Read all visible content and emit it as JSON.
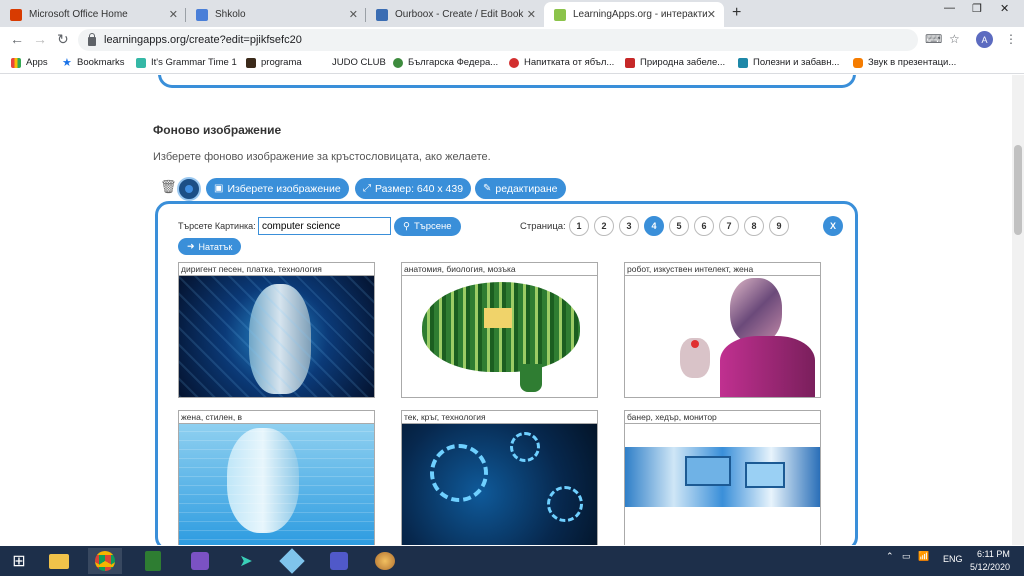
{
  "browser": {
    "tabs": [
      {
        "title": "Microsoft Office Home",
        "icon": "office-icon",
        "color": "#d83b01"
      },
      {
        "title": "Shkolo",
        "icon": "shkolo-icon",
        "color": "#4a7fd8"
      },
      {
        "title": "Ourboox - Create / Edit Book",
        "icon": "ourboox-icon",
        "color": "#3b6db3"
      },
      {
        "title": "LearningApps.org - интерактиви",
        "icon": "learningapps-icon",
        "color": "#8bc34a"
      }
    ],
    "url": "learningapps.org/create?edit=pjikfsefc20",
    "avatar_letter": "A",
    "bookmarks": [
      {
        "label": "Apps",
        "icon": "apps-grid-icon",
        "color": "#e8453c"
      },
      {
        "label": "Bookmarks",
        "icon": "star-icon",
        "color": "#1a73e8"
      },
      {
        "label": "It's Grammar Time 1",
        "icon": "send-icon",
        "color": "#35b8a6"
      },
      {
        "label": "programa",
        "icon": "programa-icon",
        "color": "#3b2a1a"
      },
      {
        "label": "JUDO CLUB",
        "icon": "",
        "color": ""
      },
      {
        "label": "Българска Федера...",
        "icon": "federation-icon",
        "color": "#3d8b3d"
      },
      {
        "label": "Напитката от ябъл...",
        "icon": "apple-drink-icon",
        "color": "#d32f2f"
      },
      {
        "label": "Природна забеле...",
        "icon": "nature-icon",
        "color": "#c62828"
      },
      {
        "label": "Полезни и забавн...",
        "icon": "useful-icon",
        "color": "#1e88a8"
      },
      {
        "label": "Звук в презентаци...",
        "icon": "sound-icon",
        "color": "#f57c00"
      }
    ]
  },
  "section": {
    "title": "Фоново изображение",
    "description": "Изберете фоново изображение за кръстословицата, ако желаете."
  },
  "toolbar": {
    "choose_image": "Изберете изображение",
    "size": "Размер: 640 x 439",
    "edit": "редактиране"
  },
  "search": {
    "label": "Търсете Картинка:",
    "value": "computer science",
    "button": "Търсене",
    "page_label": "Страница:",
    "pages": [
      "1",
      "2",
      "3",
      "4",
      "5",
      "6",
      "7",
      "8",
      "9"
    ],
    "current_page": "4",
    "close": "X",
    "next": "Нататък"
  },
  "results": [
    {
      "caption": "диригент песен, платка, технология",
      "kind": "cyber-face"
    },
    {
      "caption": "анатомия, биология, мозъка",
      "kind": "circuit-brain"
    },
    {
      "caption": "робот, изкуствен интелект, жена",
      "kind": "robot-woman"
    },
    {
      "caption": "жена, стилен, в",
      "kind": "binary-face"
    },
    {
      "caption": "тек, кръг, технология",
      "kind": "tech-circles"
    },
    {
      "caption": "банер, хедър, монитор",
      "kind": "banner-monitor"
    }
  ],
  "taskbar": {
    "apps": [
      "start-icon",
      "file-explorer-icon",
      "chrome-icon",
      "calculator-icon",
      "visual-studio-icon",
      "send-app-icon",
      "box-app-icon",
      "teams-icon",
      "paint-icon"
    ],
    "language": "ENG",
    "time": "6:11 PM",
    "date": "5/12/2020"
  }
}
